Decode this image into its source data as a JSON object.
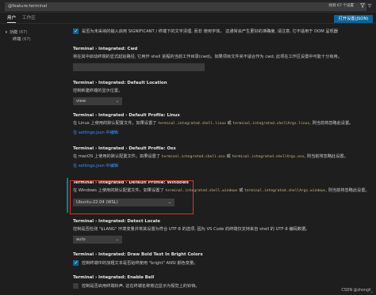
{
  "search": {
    "value": "@feature:terminal",
    "result_count": "找到 67 个设置"
  },
  "tabs": {
    "user": "用户",
    "workspace": "工作区",
    "open_json": "打开设置(JSON)"
  },
  "sidebar": {
    "items": [
      {
        "label": "功能",
        "count": "(67)",
        "chevron": "∨"
      },
      {
        "label": "终端",
        "count": "(67)",
        "chevron": ""
      }
    ]
  },
  "settings": {
    "s0": {
      "desc": "是否为未采纳的输入启用 SIGNIFICANT / 终端下的文字清理, 而非 使用字体。 这通常会产生更好的准确度, 请注意, 它不适用于 DOM 呈现器"
    },
    "cwd": {
      "cat": "Terminal › Integrated: ",
      "name": "Cwd",
      "desc": "将在其中启动终端的显式起始路径, 它用作 shell 进程的当前工作目录(cwd)。如果项目文件夹不适合作为 cwd, 此项在工作区设置中可能十分有用。"
    },
    "default_location": {
      "cat": "Terminal › Integrated: ",
      "name": "Default Location",
      "desc": "控制新建终端的显示位置。",
      "value": "view"
    },
    "profile_linux": {
      "cat": "Terminal › Integrated › Default Profile: ",
      "name": "Linux",
      "desc_a": "在 Linux 上使用的默认配置文件。如果设置了 ",
      "code_a": "terminal.integrated.shell.linux",
      "desc_b": " 或 ",
      "code_b": "terminal.integrated.shellArgs.linux",
      "desc_c": ", 则当前将忽略此设置。",
      "link": "在 settings.json 中编辑"
    },
    "profile_osx": {
      "cat": "Terminal › Integrated › Default Profile: ",
      "name": "Osx",
      "desc_a": "在 macOS 上使用的默认配置文件。如果设置了 ",
      "code_a": "terminal.integrated.shell.osx",
      "desc_b": " 或 ",
      "code_b": "terminal.integrated.shellArgs.osx",
      "desc_c": ", 则当前将忽略此设置。",
      "link": "在 settings.json 中编辑"
    },
    "profile_windows": {
      "cat": "Terminal › Integrated › Default Profile: ",
      "name": "Windows",
      "desc_a": "在 Windows 上使用的默认配置文件。如果设置了 ",
      "code_a": "terminal.integrated.shell.windows",
      "desc_b": " 或 ",
      "code_b": "terminal.integrated.shellArgs.windows",
      "desc_c": ", 则当前将忽略此设置。",
      "value": "Ubuntu-22.04 (WSL)"
    },
    "detect_locale": {
      "cat": "Terminal › Integrated: ",
      "name": "Detect Locale",
      "desc": "控制是否检测 \"$LANG\" 环境变量并将其设置为符合 UTF-8 的选项, 因为 VS Code 的终端仅支持来自 shell 的 UTF-8 编码数据。",
      "value": "auto"
    },
    "draw_bold": {
      "cat": "Terminal › Integrated: ",
      "name": "Draw Bold Text In Bright Colors",
      "desc": "控制终端中的加粗文本是否始终使用 \"bright\" ANSI 颜色变量。"
    },
    "enable_bell": {
      "cat": "Terminal › Integrated: ",
      "name": "Enable Bell",
      "desc": "控制是否启用终端铃声, 这在终端名称旁边显示为视觉上的铃铛。"
    }
  },
  "watermark": "CSDN @zhongli_"
}
